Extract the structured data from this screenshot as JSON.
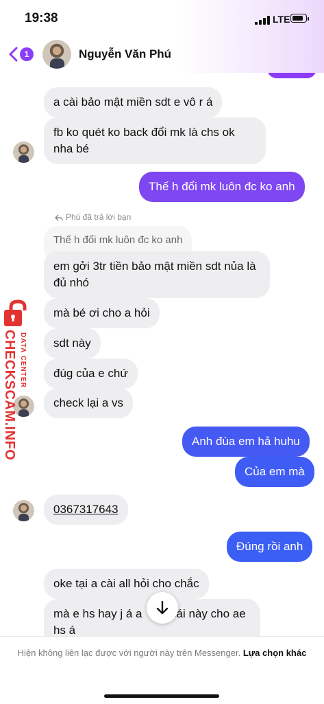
{
  "status_bar": {
    "time": "19:38",
    "network": "LTE"
  },
  "header": {
    "back_badge": "1",
    "contact_name": "Nguyễn Văn Phú"
  },
  "colors": {
    "accent": "#8b3cf7",
    "outgoing_blue": "#3b5ff5",
    "incoming_bg": "#eeeef0",
    "watermark_red": "#e23333"
  },
  "messages": [
    {
      "dir": "in",
      "text": "a cài bảo mật miền sdt e vô r á"
    },
    {
      "dir": "in",
      "text": "fb ko quét ko back đổi mk là chs ok nha bé"
    },
    {
      "dir": "out",
      "text": "Thế h đổi mk luôn đc ko anh"
    },
    {
      "dir": "reply",
      "label": "Phú đã trả lời bạn",
      "quote": "Thế h đổi mk luôn đc ko anh"
    },
    {
      "dir": "in",
      "text": "em gởi 3tr tiền bảo mật miền sdt nủa là đủ nhó"
    },
    {
      "dir": "in",
      "text": "mà bé ơi cho a hỏi"
    },
    {
      "dir": "in",
      "text": "sdt này"
    },
    {
      "dir": "in",
      "text": "đúg của e chứ"
    },
    {
      "dir": "in",
      "text": "check lại a vs"
    },
    {
      "dir": "out",
      "text": "Anh đùa em hả huhu"
    },
    {
      "dir": "out",
      "text": "Của em mà"
    },
    {
      "dir": "in",
      "text": "0367317643"
    },
    {
      "dir": "out",
      "text": "Đúng rồi anh"
    },
    {
      "dir": "in",
      "text": "oke tại a cài all hỏi cho chắc"
    },
    {
      "dir": "in",
      "text": "mà e hs hay j á a",
      "text_tail": "k cái này cho ae hs á"
    }
  ],
  "footer": {
    "notice": "Hiện không liên lạc được với người này trên Messenger.",
    "link": "Lựa chọn khác"
  },
  "watermark": {
    "brand": "CHECKSCAM.INFO",
    "subtitle": "DATA CENTER"
  }
}
